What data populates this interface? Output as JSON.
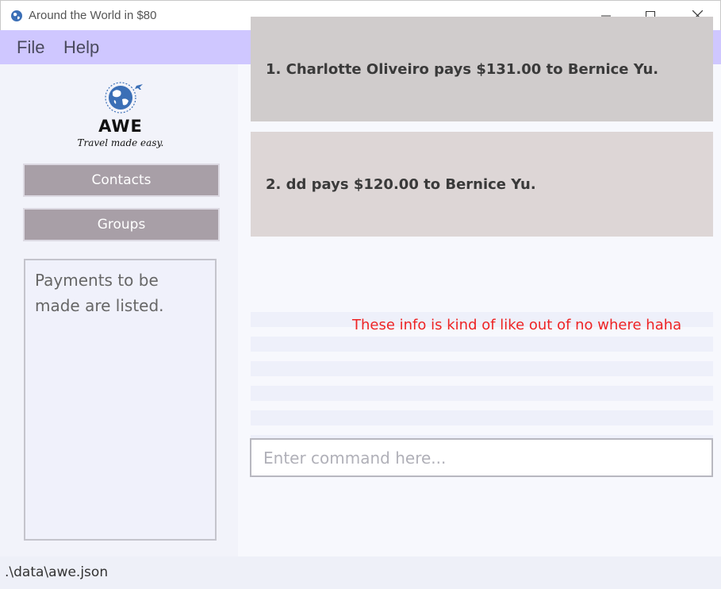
{
  "window": {
    "title": "Around the World in $80",
    "icon": "globe-icon",
    "controls": [
      "minimize-icon",
      "maximize-icon",
      "close-icon"
    ]
  },
  "menu": {
    "items": [
      {
        "label": "File"
      },
      {
        "label": "Help"
      }
    ]
  },
  "sidebar": {
    "logo": {
      "brand": "AWE",
      "tagline": "Travel made easy."
    },
    "buttons": [
      {
        "label": "Contacts"
      },
      {
        "label": "Groups"
      }
    ],
    "info_text": "Payments to be made are listed."
  },
  "main": {
    "payments": [
      {
        "text": "1. Charlotte Oliveiro pays $131.00 to Bernice Yu."
      },
      {
        "text": "2. dd pays $120.00 to Bernice Yu."
      }
    ],
    "annotation": "These info is kind of like out of no where haha",
    "command": {
      "value": "",
      "placeholder": "Enter command here..."
    }
  },
  "status": {
    "file_path": ".\\data\\awe.json"
  },
  "colors": {
    "menubar": "#cfc7ff",
    "button": "#a89fa7",
    "card_1": "#d0cccc",
    "card_2": "#ddd6d6",
    "annotation": "#ee2424"
  }
}
